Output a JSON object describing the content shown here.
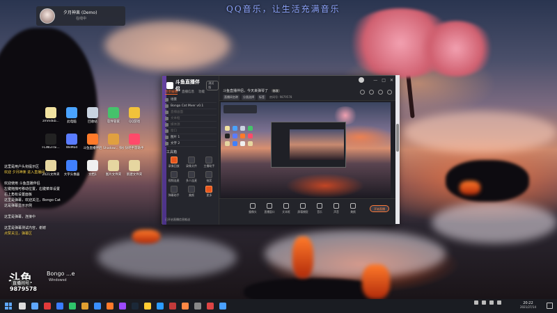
{
  "banner": "QQ音乐，让生活充满音乐",
  "profile": {
    "name": "夕月神楽 (Demo)",
    "status": "在线中"
  },
  "desktop_icons": [
    {
      "label": "zmmdkb...",
      "color": "#f1e2a0"
    },
    {
      "label": "此电脑",
      "color": "#4aa3ff"
    },
    {
      "label": "回收站",
      "color": "#c9d3e0"
    },
    {
      "label": "软件管家",
      "color": "#45c26b"
    },
    {
      "label": "QQ游戏",
      "color": "#f2c23a"
    },
    {
      "label": "FLiNGTrai...",
      "color": "#222"
    },
    {
      "label": "WeMod",
      "color": "#5a7cff"
    },
    {
      "label": "斗鱼直播伴侣",
      "color": "#ff7a2a"
    },
    {
      "label": "Shadow... 快捷方式",
      "color": "#e0a040"
    },
    {
      "label": "快吧手游助手",
      "color": "#ff4a6a"
    },
    {
      "label": "2021文件夹",
      "color": "#e6d6a0"
    },
    {
      "label": "大字头像器",
      "color": "#4080ff"
    },
    {
      "label": "文档1",
      "color": "#f0f0f0"
    },
    {
      "label": "图片文件夹",
      "color": "#e6d6a0"
    },
    {
      "label": "新建文件夹",
      "color": "#e6d6a0"
    }
  ],
  "chat": [
    {
      "text": "这里是用户头衔提示区",
      "style": ""
    },
    {
      "text": "欢迎 夕月神楽 进入直播间",
      "style": "y"
    },
    {
      "text": "",
      "style": ""
    },
    {
      "text": "欢迎使用 斗鱼直播伴侣",
      "style": ""
    },
    {
      "text": "左键拖拽可移动位置，右键菜单设置",
      "style": ""
    },
    {
      "text": "右上角有设置面板",
      "style": ""
    },
    {
      "text": "这里是弹幕，欢迎关注，Bongo Cat",
      "style": ""
    },
    {
      "text": "这是弹幕显示示例",
      "style": ""
    },
    {
      "text": "",
      "style": ""
    },
    {
      "text": "这里是弹幕，连接中",
      "style": ""
    },
    {
      "text": "",
      "style": ""
    },
    {
      "text": "这里是弹幕测试内容，谢谢",
      "style": ""
    },
    {
      "text": "点赞关注，弹幕区",
      "style": "y"
    }
  ],
  "douyu": {
    "logo": "斗鱼",
    "sub": "直播间号",
    "room": "9879578"
  },
  "bongo": {
    "label": "Bongo ...e",
    "mark": "Windowsd"
  },
  "app": {
    "name": "斗鱼直播伴侣",
    "version": "测试版",
    "window_buttons": [
      "—",
      "□",
      "✕"
    ],
    "tabs": [
      "场景编辑",
      "直播信息",
      "功能"
    ],
    "scenes": [
      {
        "label": "场景",
        "muted": false
      },
      {
        "label": "Bongo Cat Mver v0.1",
        "muted": false
      },
      {
        "label": "直播画面",
        "muted": true
      },
      {
        "label": "文本框",
        "muted": true
      },
      {
        "label": "媒体源",
        "muted": true
      },
      {
        "label": "窗口",
        "muted": true
      },
      {
        "label": "图片 1",
        "muted": false
      },
      {
        "label": "文字 2",
        "muted": false
      }
    ],
    "tools_title": "工具箱",
    "tools": [
      {
        "label": "录像回放",
        "accent": true
      },
      {
        "label": "录像文件",
        "accent": false
      },
      {
        "label": "主播助手",
        "accent": false
      },
      {
        "label": "视频连麦",
        "accent": false
      },
      {
        "label": "多人连麦",
        "accent": false
      },
      {
        "label": "抽奖",
        "accent": false
      },
      {
        "label": "弹幕助手",
        "accent": false
      },
      {
        "label": "美颜",
        "accent": false
      },
      {
        "label": "更多",
        "accent": true
      }
    ],
    "bottom_check": "已开启直播信息推送",
    "room_title": "斗鱼直播伴侣，今天来弹琴了",
    "edit_label": "修改",
    "tags": [
      "直播间名称",
      "分类选择",
      "标签",
      "房间号: 9879578"
    ],
    "bottom_tools": [
      "摄像头",
      "直播窗口",
      "文本框",
      "屏幕捕捉",
      "音乐",
      "声音",
      "美颜"
    ],
    "live_button": "开始直播"
  },
  "taskbar": {
    "time": "20:22",
    "date": "2021/27/14"
  }
}
